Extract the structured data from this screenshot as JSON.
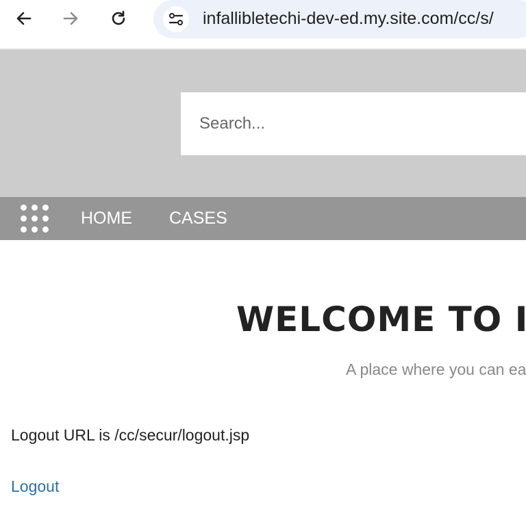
{
  "browser": {
    "url": "infallibletechi-dev-ed.my.site.com/cc/s/",
    "icons": [
      "back-arrow-icon",
      "forward-arrow-icon",
      "reload-icon",
      "site-info-icon"
    ]
  },
  "header": {
    "search_placeholder": "Search...",
    "background_color": "#cccccc"
  },
  "nav": {
    "launcher_icon": "app-launcher-dots-icon",
    "items": [
      {
        "label": "HOME"
      },
      {
        "label": "CASES"
      }
    ],
    "background_color": "#969696"
  },
  "main": {
    "title": "WELCOME TO I",
    "subtitle": "A place where you can ea",
    "logout_info": "Logout URL is /cc/secur/logout.jsp",
    "logout_link": "Logout",
    "link_color": "#2f6fa0"
  }
}
